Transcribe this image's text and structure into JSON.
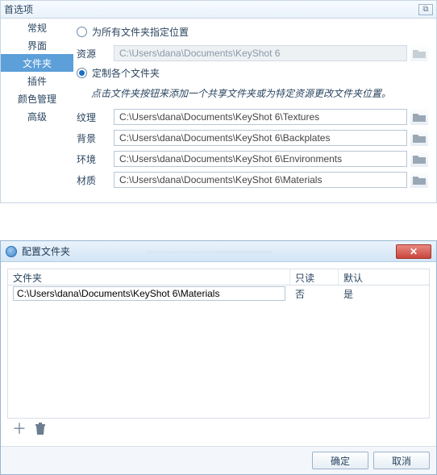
{
  "prefs": {
    "title": "首选项",
    "close_glyph": "⧉",
    "sidebar": {
      "items": [
        {
          "label": "常规"
        },
        {
          "label": "界面"
        },
        {
          "label": "文件夹"
        },
        {
          "label": "插件"
        },
        {
          "label": "颜色管理"
        },
        {
          "label": "高级"
        }
      ],
      "active_index": 2
    },
    "radios": {
      "all_label": "为所有文件夹指定位置",
      "custom_label": "定制各个文件夹"
    },
    "resource": {
      "label": "资源",
      "value": "C:\\Users\\dana\\Documents\\KeyShot 6"
    },
    "hint": "点击文件夹按钮来添加一个共享文件夹或为特定资源更改文件夹位置。",
    "fields": [
      {
        "label": "纹理",
        "value": "C:\\Users\\dana\\Documents\\KeyShot 6\\Textures"
      },
      {
        "label": "背景",
        "value": "C:\\Users\\dana\\Documents\\KeyShot 6\\Backplates"
      },
      {
        "label": "环境",
        "value": "C:\\Users\\dana\\Documents\\KeyShot 6\\Environments"
      },
      {
        "label": "材质",
        "value": "C:\\Users\\dana\\Documents\\KeyShot 6\\Materials"
      }
    ]
  },
  "config": {
    "title": "配置文件夹",
    "blur_text": "····················································",
    "close_glyph": "✕",
    "columns": {
      "c1": "文件夹",
      "c2": "只读",
      "c3": "默认"
    },
    "rows": [
      {
        "path": "C:\\Users\\dana\\Documents\\KeyShot 6\\Materials",
        "readonly": "否",
        "default": "是"
      }
    ],
    "add_glyph": "＋",
    "buttons": {
      "ok": "确定",
      "cancel": "取消"
    }
  }
}
